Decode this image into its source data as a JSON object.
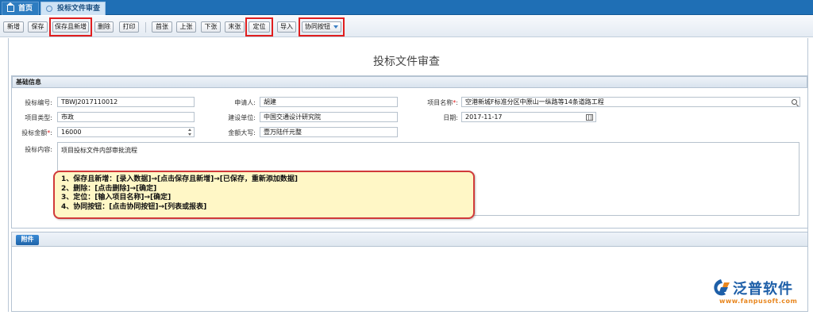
{
  "tabs": {
    "home": "首页",
    "active": "投标文件审查"
  },
  "toolbar": {
    "new": "新增",
    "save": "保存",
    "save_new": "保存且新增",
    "delete": "删除",
    "print": "打印",
    "first": "首张",
    "prev": "上张",
    "next": "下张",
    "last": "末张",
    "locate": "定位",
    "import": "导入",
    "collab": "协同按钮"
  },
  "page_title": "投标文件审查",
  "basic": {
    "section_title": "基础信息",
    "bid_no_label": "投标编号:",
    "bid_no": "TBWJ2017110012",
    "applicant_label": "申请人:",
    "applicant": "胡建",
    "project_name_label": "项目名称",
    "project_name_suffix": ":",
    "project_name": "空港新城F标准分区中原山一纵路等14条道路工程",
    "project_type_label": "项目类型:",
    "project_type": "市政",
    "builder_label": "建设单位:",
    "builder": "中国交通设计研究院",
    "date_label": "日期:",
    "date": "2017-11-17",
    "amount_label": "投标金额",
    "amount_suffix": ":",
    "amount": "16000",
    "amount_upper_label": "金额大写:",
    "amount_upper": "壹万陆仟元整",
    "content_label": "投标内容:",
    "content": "项目投标文件内部审批流程",
    "required_mark": "*"
  },
  "note": {
    "line1": "1、保存且新增：[录入数据]→[点击保存且新增]→[已保存，重新添加数据]",
    "line2": "2、删除：[点击删除]→[确定]",
    "line3": "3、定位：[输入项目名称]→[确定]",
    "line4": "4、协同按钮：[点击协同按钮]→[列表或报表]"
  },
  "attachments": {
    "button": "附件"
  },
  "logo": {
    "name": "泛普软件",
    "url": "www.fanpusoft.com"
  },
  "colors": {
    "tabbar": "#1f6fb5",
    "highlight": "#e01e1e",
    "note_bg": "#fff7c6",
    "logo_blue": "#1e5fa8",
    "logo_orange": "#e8861e"
  }
}
